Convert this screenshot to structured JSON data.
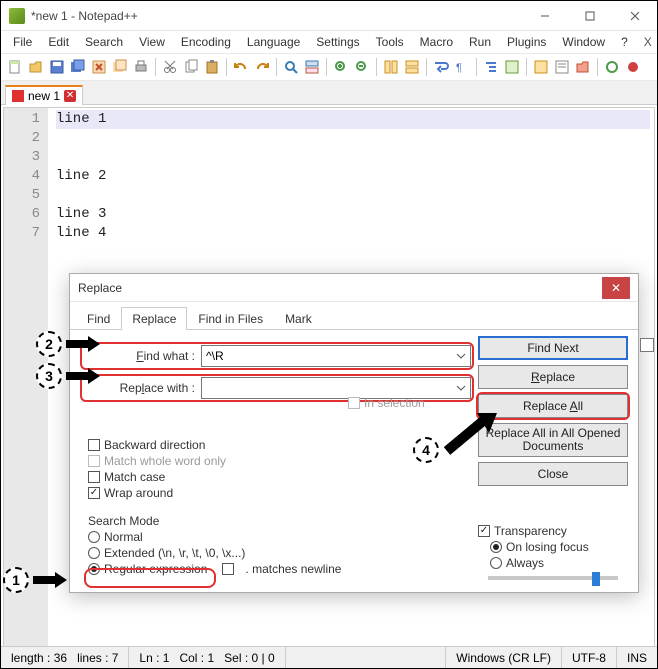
{
  "window": {
    "title": "*new 1 - Notepad++"
  },
  "menu": {
    "file": "File",
    "edit": "Edit",
    "search": "Search",
    "view": "View",
    "encoding": "Encoding",
    "language": "Language",
    "settings": "Settings",
    "tools": "Tools",
    "macro": "Macro",
    "run": "Run",
    "plugins": "Plugins",
    "window": "Window",
    "help": "?",
    "x": "X"
  },
  "tab": {
    "name": "new 1"
  },
  "editor": {
    "lines": [
      "line 1",
      "",
      "",
      "line 2",
      "",
      "line 3",
      "line 4"
    ],
    "gutter": [
      "1",
      "2",
      "3",
      "4",
      "5",
      "6",
      "7"
    ]
  },
  "dialog": {
    "title": "Replace",
    "tabs": {
      "find": "Find",
      "replace": "Replace",
      "find_in_files": "Find in Files",
      "mark": "Mark"
    },
    "find_label": "Find what :",
    "find_value": "^\\R",
    "replace_label": "Replace with :",
    "replace_value": "",
    "in_selection": "In selection",
    "backward": "Backward direction",
    "whole_word": "Match whole word only",
    "match_case": "Match case",
    "wrap": "Wrap around",
    "search_mode_label": "Search Mode",
    "mode_normal": "Normal",
    "mode_extended": "Extended (\\n, \\r, \\t, \\0, \\x...)",
    "mode_regex": "Regular expression",
    "matches_newline": ". matches newline",
    "transparency": "Transparency",
    "on_losing": "On losing focus",
    "always": "Always",
    "btn_find_next": "Find Next",
    "btn_replace": "Replace",
    "btn_replace_all": "Replace All",
    "btn_replace_all_open": "Replace All in All Opened Documents",
    "btn_close": "Close"
  },
  "status": {
    "length": "length : 36",
    "lines": "lines : 7",
    "ln": "Ln : 1",
    "col": "Col : 1",
    "sel": "Sel : 0 | 0",
    "eol": "Windows (CR LF)",
    "enc": "UTF-8",
    "mode": "INS"
  },
  "annotations": {
    "n1": "1",
    "n2": "2",
    "n3": "3",
    "n4": "4"
  }
}
